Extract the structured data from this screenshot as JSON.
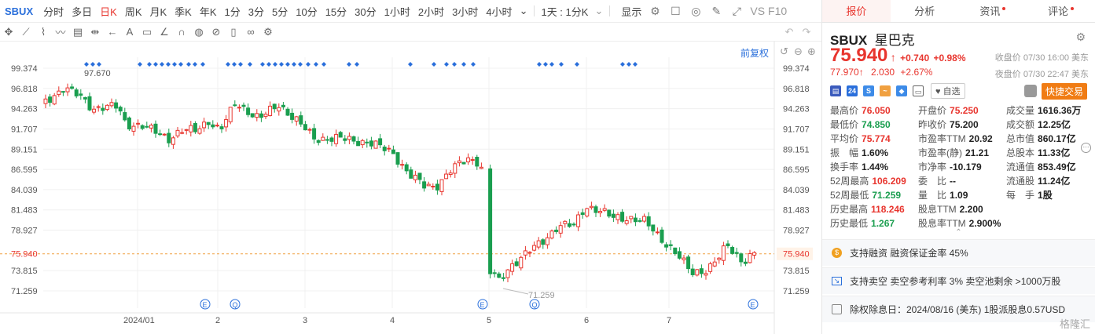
{
  "toolbar": {
    "symbol": "SBUX",
    "timeframes": [
      "分时",
      "多日",
      "日K",
      "周K",
      "月K",
      "季K",
      "年K",
      "1分",
      "3分",
      "5分",
      "10分",
      "15分",
      "30分",
      "1小时",
      "2小时",
      "3小时",
      "4小时"
    ],
    "active_timeframe": "日K",
    "four_hour_dropdown": "⌄",
    "multi_chart": "1天 : 1分K",
    "display_label": "显示",
    "vs_label": "VS",
    "f10_label": "F10"
  },
  "chart_header": {
    "adjust_label": "前复权"
  },
  "chart_data": {
    "type": "candlestick",
    "y_ticks": [
      "99.374",
      "96.818",
      "94.263",
      "91.707",
      "89.151",
      "86.595",
      "84.039",
      "81.483",
      "78.927",
      "75.940",
      "73.815",
      "71.259"
    ],
    "current_price_label": "75.940",
    "x_labels": [
      "2024/01",
      "2",
      "3",
      "4",
      "5",
      "6",
      "7"
    ],
    "high_annotation": "97.670",
    "low_annotation": "71.259",
    "event_markers": [
      {
        "label": "E",
        "month": "2"
      },
      {
        "label": "Q",
        "month": "2"
      },
      {
        "label": "E",
        "month": "5"
      },
      {
        "label": "Q",
        "month": "5"
      },
      {
        "label": "E",
        "month": "7"
      }
    ],
    "colors": {
      "up": "#e8352e",
      "down": "#1a9e4f",
      "price_line": "#f0a040",
      "marker": "#2a6fdb"
    }
  },
  "panel": {
    "tabs": [
      {
        "label": "报价",
        "active": true,
        "dot": false
      },
      {
        "label": "分析",
        "active": false,
        "dot": false
      },
      {
        "label": "资讯",
        "active": false,
        "dot": true
      },
      {
        "label": "评论",
        "active": false,
        "dot": true
      }
    ],
    "code": "SBUX",
    "name": "星巴克",
    "price": "75.940",
    "change": "+0.740",
    "change_pct": "+0.98%",
    "close_time": "收盘价 07/30 16:00 美东",
    "after_price": "77.970",
    "after_change": "2.030",
    "after_pct": "+2.67%",
    "after_time": "夜盘价 07/30 22:47 美东",
    "watchlist_label": "自选",
    "fast_trade_label": "快捷交易",
    "stats": [
      {
        "label": "最高价",
        "value": "76.050",
        "color": "red"
      },
      {
        "label": "开盘价",
        "value": "75.250",
        "color": "red"
      },
      {
        "label": "成交量",
        "value": "1616.36万",
        "color": ""
      },
      {
        "label": "最低价",
        "value": "74.850",
        "color": "green"
      },
      {
        "label": "昨收价",
        "value": "75.200",
        "color": ""
      },
      {
        "label": "成交额",
        "value": "12.25亿",
        "color": ""
      },
      {
        "label": "平均价",
        "value": "75.774",
        "color": "red"
      },
      {
        "label": "市盈率TTM",
        "value": "20.92",
        "color": ""
      },
      {
        "label": "总市值",
        "value": "860.17亿",
        "color": ""
      },
      {
        "label": "振　幅",
        "value": "1.60%",
        "color": ""
      },
      {
        "label": "市盈率(静)",
        "value": "21.21",
        "color": ""
      },
      {
        "label": "总股本",
        "value": "11.33亿",
        "color": ""
      },
      {
        "label": "换手率",
        "value": "1.44%",
        "color": ""
      },
      {
        "label": "市净率",
        "value": "-10.179",
        "color": ""
      },
      {
        "label": "流通值",
        "value": "853.49亿",
        "color": ""
      },
      {
        "label": "52周最高",
        "value": "106.209",
        "color": "red"
      },
      {
        "label": "委　比",
        "value": "--",
        "color": ""
      },
      {
        "label": "流通股",
        "value": "11.24亿",
        "color": ""
      },
      {
        "label": "52周最低",
        "value": "71.259",
        "color": "green"
      },
      {
        "label": "量　比",
        "value": "1.09",
        "color": ""
      },
      {
        "label": "每　手",
        "value": "1股",
        "color": ""
      },
      {
        "label": "历史最高",
        "value": "118.246",
        "color": "red"
      },
      {
        "label": "股息TTM",
        "value": "2.200",
        "color": ""
      },
      {
        "label": "",
        "value": "",
        "color": ""
      },
      {
        "label": "历史最低",
        "value": "1.267",
        "color": "green"
      },
      {
        "label": "股息率TTM",
        "value": "2.900%",
        "color": ""
      },
      {
        "label": "",
        "value": "",
        "color": ""
      }
    ],
    "info1": "支持融资 融资保证金率 45%",
    "info2": "支持卖空 卖空参考利率 3% 卖空池剩余 >1000万股",
    "info3": "除权除息日：2024/08/16 (美东) 1股派股息0.57USD",
    "watermark": "格隆汇"
  }
}
